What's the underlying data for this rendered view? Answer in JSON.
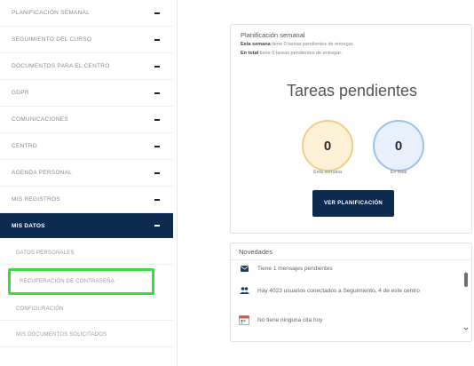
{
  "sidebar": {
    "items": [
      {
        "label": "Planificación semanal"
      },
      {
        "label": "Seguimiento del curso"
      },
      {
        "label": "Documentos para el centro"
      },
      {
        "label": "GDPR"
      },
      {
        "label": "Comunicaciones"
      },
      {
        "label": "Centro"
      },
      {
        "label": "Agenda personal"
      },
      {
        "label": "Mis registros"
      },
      {
        "label": "Mis datos"
      }
    ],
    "subitems": [
      {
        "label": "Datos personales"
      },
      {
        "label": "Recuperación de contraseña"
      },
      {
        "label": "Configuración"
      },
      {
        "label": "Mis documentos solicitados"
      }
    ],
    "colors": {
      "active_bg": "#0d2a4f",
      "highlight_border": "#3ddc3d"
    }
  },
  "planning": {
    "title": "Planificación semanal",
    "week_bold": "Esta semana",
    "week_text": "tiene 0 tareas pendientes de entregar.",
    "total_bold": "En total",
    "total_text": "tiene 0 tareas pendientes de entregar.",
    "heading": "Tareas pendientes",
    "week_count": "0",
    "week_caption": "Esta semana",
    "total_count": "0",
    "total_caption": "En total",
    "button_label": "Ver planificación"
  },
  "news": {
    "title": "Novedades",
    "items": [
      {
        "icon": "envelope-icon",
        "text": "Tiene 1 mensajes pendientes"
      },
      {
        "icon": "users-icon",
        "text": "Hay 4023 usuarios conectados a Seguimiento, 4 de este centro"
      },
      {
        "icon": "calendar-icon",
        "text": "No tiene ninguna cita hoy"
      }
    ]
  }
}
